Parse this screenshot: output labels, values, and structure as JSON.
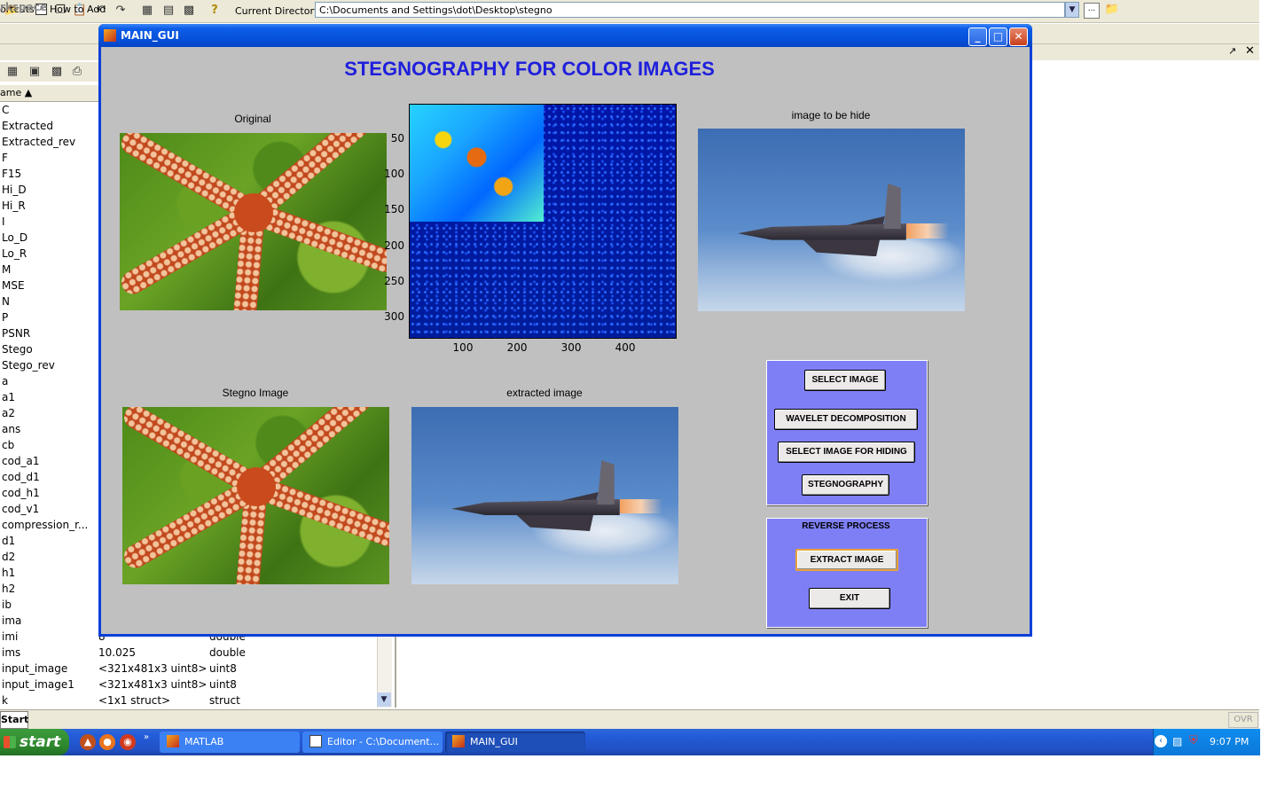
{
  "toolbar": {
    "current_directory_label": "Current Directory:",
    "current_directory_value": "C:\\Documents and Settings\\dot\\Desktop\\stegno"
  },
  "shortcuts_bar": {
    "shortcuts_label": "ortcuts",
    "how_to_add": "How to Add"
  },
  "workspace": {
    "title": "rkspace",
    "column_name": "ame",
    "rows": [
      {
        "name": "C",
        "value": "",
        "class": ""
      },
      {
        "name": "Extracted",
        "value": "",
        "class": ""
      },
      {
        "name": "Extracted_rev",
        "value": "",
        "class": ""
      },
      {
        "name": "F",
        "value": "",
        "class": ""
      },
      {
        "name": "F15",
        "value": "",
        "class": ""
      },
      {
        "name": "Hi_D",
        "value": "",
        "class": ""
      },
      {
        "name": "Hi_R",
        "value": "",
        "class": ""
      },
      {
        "name": "I",
        "value": "",
        "class": ""
      },
      {
        "name": "Lo_D",
        "value": "",
        "class": ""
      },
      {
        "name": "Lo_R",
        "value": "",
        "class": ""
      },
      {
        "name": "M",
        "value": "",
        "class": ""
      },
      {
        "name": "MSE",
        "value": "",
        "class": ""
      },
      {
        "name": "N",
        "value": "",
        "class": ""
      },
      {
        "name": "P",
        "value": "",
        "class": ""
      },
      {
        "name": "PSNR",
        "value": "",
        "class": ""
      },
      {
        "name": "Stego",
        "value": "",
        "class": ""
      },
      {
        "name": "Stego_rev",
        "value": "",
        "class": ""
      },
      {
        "name": "a",
        "value": "",
        "class": ""
      },
      {
        "name": "a1",
        "value": "",
        "class": ""
      },
      {
        "name": "a2",
        "value": "",
        "class": ""
      },
      {
        "name": "ans",
        "value": "",
        "class": ""
      },
      {
        "name": "cb",
        "value": "",
        "class": ""
      },
      {
        "name": "cod_a1",
        "value": "",
        "class": ""
      },
      {
        "name": "cod_d1",
        "value": "",
        "class": ""
      },
      {
        "name": "cod_h1",
        "value": "",
        "class": ""
      },
      {
        "name": "cod_v1",
        "value": "",
        "class": ""
      },
      {
        "name": "compression_r...",
        "value": "",
        "class": ""
      },
      {
        "name": "d1",
        "value": "",
        "class": ""
      },
      {
        "name": "d2",
        "value": "",
        "class": ""
      },
      {
        "name": "h1",
        "value": "",
        "class": ""
      },
      {
        "name": "h2",
        "value": "",
        "class": ""
      },
      {
        "name": "ib",
        "value": "",
        "class": ""
      },
      {
        "name": "ima",
        "value": "",
        "class": ""
      },
      {
        "name": "imi",
        "value": "8",
        "class": "double"
      },
      {
        "name": "ims",
        "value": "10.025",
        "class": "double"
      },
      {
        "name": "input_image",
        "value": "<321x481x3 uint8>",
        "class": "uint8"
      },
      {
        "name": "input_image1",
        "value": "<321x481x3 uint8>",
        "class": "uint8"
      },
      {
        "name": "k",
        "value": "<1x1 struct>",
        "class": "struct"
      }
    ]
  },
  "status": {
    "start_small": "Start",
    "ovr": "OVR"
  },
  "taskbar": {
    "start_label": "start",
    "tasks": [
      {
        "label": "MATLAB"
      },
      {
        "label": "Editor - C:\\Document..."
      },
      {
        "label": "MAIN_GUI"
      }
    ],
    "clock": "9:07 PM"
  },
  "gui": {
    "window_title": "MAIN_GUI",
    "heading": "STEGNOGRAPHY FOR COLOR IMAGES",
    "captions": {
      "original": "Original",
      "image_to_hide": "image to be hide",
      "stegno_image": "Stegno Image",
      "extracted_image": "extracted image"
    },
    "wavelet_axes": {
      "y_ticks": [
        "50",
        "100",
        "150",
        "200",
        "250",
        "300"
      ],
      "x_ticks": [
        "100",
        "200",
        "300",
        "400"
      ]
    },
    "buttons": {
      "select_image": "SELECT IMAGE",
      "wavelet_decomposition": "WAVELET DECOMPOSITION",
      "select_image_for_hiding": "SELECT IMAGE FOR HIDING",
      "stegnography": "STEGNOGRAPHY",
      "extract_image": "EXTRACT IMAGE",
      "exit": "EXIT"
    },
    "reverse_panel_title": "REVERSE PROCESS"
  }
}
